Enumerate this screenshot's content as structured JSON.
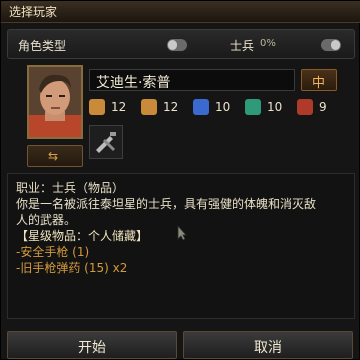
{
  "window": {
    "title": "选择玩家"
  },
  "type_bar": {
    "label": "角色类型",
    "class_name": "士兵",
    "percent": "0%"
  },
  "character": {
    "name": "艾迪生·索普",
    "gender_label": "中",
    "stats": [
      {
        "icon": "strength-icon",
        "value": "12",
        "color": "#c98b3a"
      },
      {
        "icon": "agility-icon",
        "value": "12",
        "color": "#c98b3a"
      },
      {
        "icon": "intelligence-icon",
        "value": "10",
        "color": "#3a6ad0"
      },
      {
        "icon": "perception-icon",
        "value": "10",
        "color": "#2f9a7a"
      },
      {
        "icon": "endurance-icon",
        "value": "9",
        "color": "#b03a2a"
      }
    ]
  },
  "description": {
    "lines": [
      "职业：士兵（物品）",
      "你是一名被派往泰坦星的士兵，具有强健的体魄和消灭敌",
      "人的武器。",
      "【星级物品：个人储藏】"
    ],
    "items": [
      "-安全手枪 (1)",
      "-旧手枪弹药 (15) x2"
    ]
  },
  "buttons": {
    "start": "开始",
    "cancel": "取消"
  }
}
